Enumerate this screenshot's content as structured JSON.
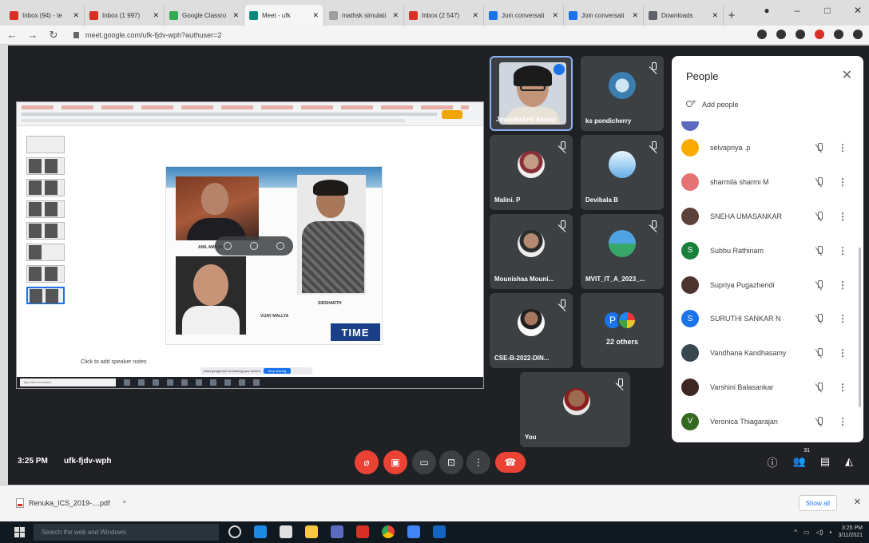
{
  "browser": {
    "tabs": [
      {
        "label": "Inbox (94) - te",
        "color": "#d93025"
      },
      {
        "label": "Inbox (1 997)",
        "color": "#d93025"
      },
      {
        "label": "Google Classro",
        "color": "#34a853"
      },
      {
        "label": "Meet - ufk",
        "color": "#00897b",
        "active": true
      },
      {
        "label": "mathsk simulati",
        "color": "#9e9e9e"
      },
      {
        "label": "Inbox (2 547)",
        "color": "#d93025"
      },
      {
        "label": "Join conversati",
        "color": "#1a73e8"
      },
      {
        "label": "Join conversati",
        "color": "#1a73e8"
      },
      {
        "label": "Downloads",
        "color": "#5f6368"
      }
    ],
    "url": "meet.google.com/ufk-fjdv-wph?authuser=2"
  },
  "presentation": {
    "caption_left": "ANIL AMBANI",
    "caption_right": "SIDDHARTH",
    "caption_bottom": "VIJAY MALLYA",
    "logo_text": "TIME",
    "speaker_notes": "Click to add speaker notes",
    "share_text": "meet.google.com is sharing your screen",
    "stop_sharing": "Stop sharing",
    "taskbar_search": "Type here to search"
  },
  "tiles": [
    {
      "name": "Jayalakshmi Anoop",
      "kind": "camera"
    },
    {
      "name": "ks pondicherry",
      "avatar": "ph2"
    },
    {
      "name": "Malini. P",
      "avatar": "ph3"
    },
    {
      "name": "Devibala B",
      "avatar": "ph4"
    },
    {
      "name": "Mounishaa Mouni...",
      "avatar": "ph5"
    },
    {
      "name": "MVIT_IT_A_2023_...",
      "avatar": "ph6"
    },
    {
      "name": "CSE-B-2022-DIN...",
      "avatar": "ph7"
    },
    {
      "name": "You",
      "avatar": "ph8"
    }
  ],
  "others": {
    "initial": "P",
    "label": "22 others"
  },
  "people": {
    "title": "People",
    "add_people": "Add people",
    "list": [
      {
        "name": "selvapriya .p",
        "color": "#f9ab00",
        "initial": ""
      },
      {
        "name": "sharmila sharmi M",
        "color": "#e57373",
        "initial": ""
      },
      {
        "name": "SNEHA UMASANKAR",
        "color": "#5d4037",
        "initial": ""
      },
      {
        "name": "Subbu Rathinam",
        "color": "#188038",
        "initial": "S"
      },
      {
        "name": "Supriya Pugazhendi",
        "color": "#4e342e",
        "initial": ""
      },
      {
        "name": "SURUTHI SANKAR N",
        "color": "#1a73e8",
        "initial": "S"
      },
      {
        "name": "Vandhana Kandhasamy",
        "color": "#37474f",
        "initial": ""
      },
      {
        "name": "Varshini Balasankar",
        "color": "#3e2723",
        "initial": ""
      },
      {
        "name": "Veronica Thiagarajan",
        "color": "#33691e",
        "initial": "V"
      }
    ]
  },
  "bottom": {
    "time": "3:25 PM",
    "code": "ufk-fjdv-wph",
    "people_count": "31"
  },
  "downloads": {
    "file": "Renuka_ICS_2019-....pdf",
    "show_all": "Show all"
  },
  "taskbar": {
    "search": "Search the web and Windows",
    "time": "3:25 PM",
    "date": "3/11/2021"
  }
}
